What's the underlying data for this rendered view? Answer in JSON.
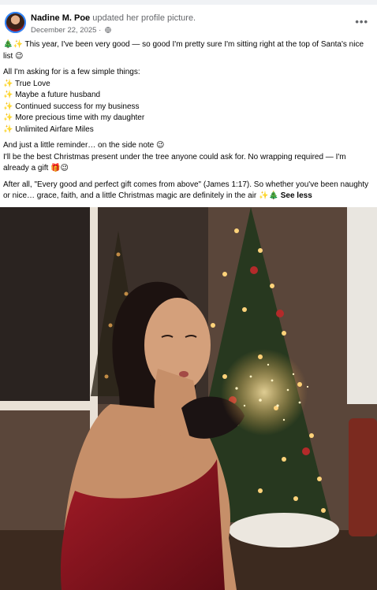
{
  "post": {
    "author": "Nadine M. Poe",
    "action": "updated her profile picture.",
    "date": "December 22, 2025",
    "separator": "·",
    "more_label": "•••",
    "lines": {
      "l1": "🎄✨ This year, I've been very good — so good I'm pretty sure I'm sitting right at the top of Santa's nice list 😉",
      "l2": "All I'm asking for is a few simple things:",
      "l3": "✨ True Love",
      "l4": "✨ Maybe a future husband",
      "l5": "✨ Continued success for my business",
      "l6": "✨ More precious time with my daughter",
      "l7": "✨ Unlimited Airfare Miles",
      "l8": "And just a little reminder… on the side note 😉",
      "l9": "I'll be the best Christmas present under the tree anyone could ask for. No wrapping required — I'm already a gift 🎁😉",
      "l10": "After all, \"Every good and perfect gift comes from above\" (James 1:17). So whether you've been naughty or nice… grace, faith, and a little Christmas magic are definitely in the air ✨🎄"
    },
    "see_less": "See less"
  },
  "colors": {
    "accent": "#1877f2",
    "secondary_text": "#65676b",
    "dress": "#8e1420",
    "tree": "#27381f",
    "sparkle": "#ffd37a"
  },
  "icons": [
    "avatar",
    "globe-icon",
    "more-options-icon"
  ]
}
